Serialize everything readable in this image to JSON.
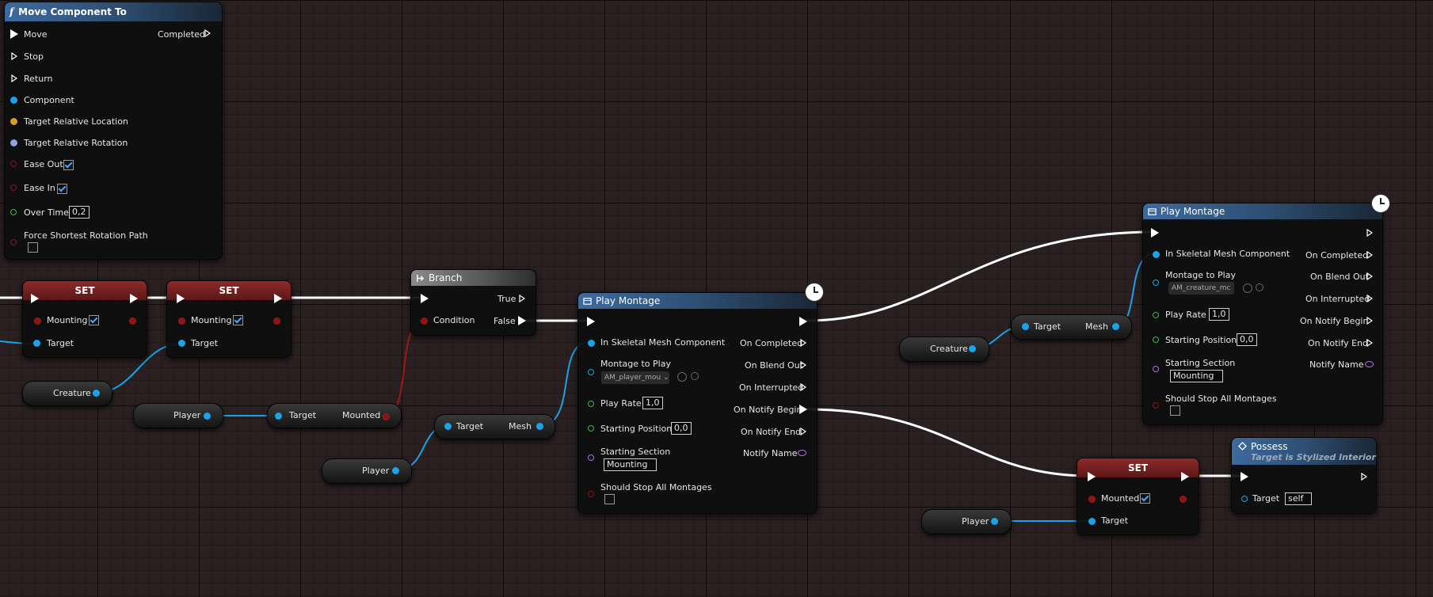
{
  "move_component": {
    "title": "Move Component To",
    "pins": {
      "move": "Move",
      "stop": "Stop",
      "return": "Return",
      "completed": "Completed",
      "component": "Component",
      "target_location": "Target Relative Location",
      "target_rotation": "Target Relative Rotation",
      "ease_out": "Ease Out",
      "ease_in": "Ease In",
      "over_time": "Over Time",
      "over_time_value": "0,2",
      "force_shortest": "Force Shortest Rotation Path"
    }
  },
  "set1": {
    "title": "SET",
    "var": "Mounting",
    "target": "Target"
  },
  "set2": {
    "title": "SET",
    "var": "Mounting",
    "target": "Target"
  },
  "set3": {
    "title": "SET",
    "var": "Mounted",
    "target": "Target"
  },
  "branch": {
    "title": "Branch",
    "true": "True",
    "false": "False",
    "condition": "Condition"
  },
  "play_montage_1": {
    "title": "Play Montage",
    "skeletal": "In Skeletal Mesh Component",
    "montage": "Montage to Play",
    "montage_value": "AM_player_mou",
    "play_rate": "Play Rate",
    "play_rate_value": "1,0",
    "start_pos": "Starting Position",
    "start_pos_value": "0,0",
    "start_section": "Starting Section",
    "start_section_value": "Mounting",
    "stop_all": "Should Stop All Montages",
    "on_completed": "On Completed",
    "on_blend_out": "On Blend Out",
    "on_interrupted": "On Interrupted",
    "on_notify_begin": "On Notify Begin",
    "on_notify_end": "On Notify End",
    "notify_name": "Notify Name"
  },
  "play_montage_2": {
    "title": "Play Montage",
    "skeletal": "In Skeletal Mesh Component",
    "montage": "Montage to Play",
    "montage_value": "AM_creature_mc",
    "play_rate": "Play Rate",
    "play_rate_value": "1,0",
    "start_pos": "Starting Position",
    "start_pos_value": "0,0",
    "start_section": "Starting Section",
    "start_section_value": "Mounting",
    "stop_all": "Should Stop All Montages",
    "on_completed": "On Completed",
    "on_blend_out": "On Blend Out",
    "on_interrupted": "On Interrupted",
    "on_notify_begin": "On Notify Begin",
    "on_notify_end": "On Notify End",
    "notify_name": "Notify Name"
  },
  "possess": {
    "title": "Possess",
    "subtitle": "Target is Stylized Interior",
    "target": "Target",
    "target_value": "self"
  },
  "vars": {
    "creature_a": "Creature",
    "player_a": "Player",
    "player_b": "Player",
    "creature_b": "Creature",
    "player_c": "Player"
  },
  "getters": {
    "mounted": {
      "target": "Target",
      "out": "Mounted"
    },
    "mesh1": {
      "target": "Target",
      "out": "Mesh"
    },
    "mesh2": {
      "target": "Target",
      "out": "Mesh"
    }
  },
  "colors": {
    "exec": "#ffffff",
    "object": "#19a3e8",
    "bool": "#8c1414",
    "float": "#3fb83f",
    "name": "#b06ee0",
    "vector": "#d4a020",
    "rotator": "#8aa4e0"
  }
}
